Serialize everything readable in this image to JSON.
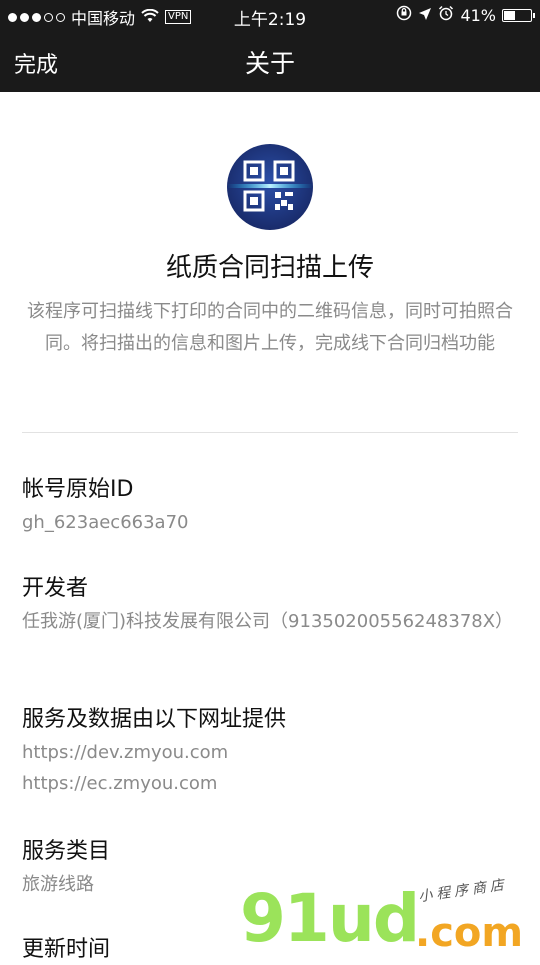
{
  "status": {
    "carrier": "中国移动",
    "vpn": "VPN",
    "time": "上午2:19",
    "battery": "41%"
  },
  "nav": {
    "done_label": "完成",
    "title": "关于"
  },
  "app": {
    "name": "纸质合同扫描上传",
    "description": "该程序可扫描线下打印的合同中的二维码信息，同时可拍照合同。将扫描出的信息和图片上传，完成线下合同归档功能"
  },
  "sections": {
    "account_id": {
      "label": "帐号原始ID",
      "value": "gh_623aec663a70"
    },
    "developer": {
      "label": "开发者",
      "value": "任我游(厦门)科技发展有限公司（91350200556248378X）"
    },
    "service_urls": {
      "label": "服务及数据由以下网址提供",
      "urls": [
        "https://dev.zmyou.com",
        "https://ec.zmyou.com"
      ]
    },
    "category": {
      "label": "服务类目",
      "value": "旅游线路"
    },
    "update_time": {
      "label": "更新时间"
    }
  },
  "watermark": {
    "main": "91ud",
    "suffix": ".com",
    "tagline": "小程序商店"
  },
  "colors": {
    "bar_bg": "#1a1a1a",
    "secondary_text": "#8a8a8a",
    "logo_blue": "#1a2d6e"
  }
}
